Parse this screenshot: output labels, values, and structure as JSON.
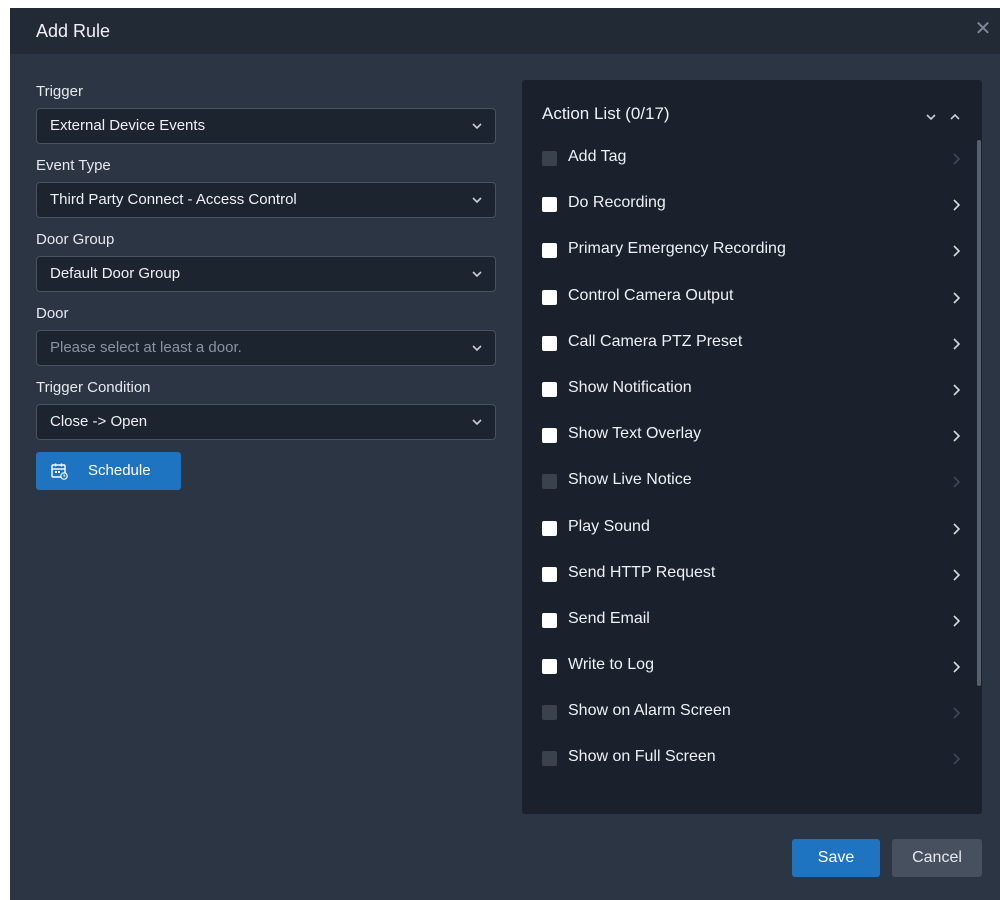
{
  "dialog": {
    "title": "Add Rule",
    "close_icon": "close-icon"
  },
  "form": {
    "fields": [
      {
        "label": "Trigger",
        "value": "External Device Events",
        "placeholder": false
      },
      {
        "label": "Event Type",
        "value": "Third Party Connect - Access Control",
        "placeholder": false
      },
      {
        "label": "Door Group",
        "value": "Default Door Group",
        "placeholder": false
      },
      {
        "label": "Door",
        "value": "Please select at least a door.",
        "placeholder": true
      },
      {
        "label": "Trigger Condition",
        "value": "Close -> Open",
        "placeholder": false
      }
    ],
    "schedule_label": "Schedule",
    "schedule_icon": "calendar-icon"
  },
  "actions": {
    "title": "Action List",
    "count": "(0/17)",
    "items": [
      {
        "label": "Add Tag",
        "disabled": true
      },
      {
        "label": "Do Recording",
        "disabled": false
      },
      {
        "label": "Primary Emergency Recording",
        "disabled": false
      },
      {
        "label": "Control Camera Output",
        "disabled": false
      },
      {
        "label": "Call Camera PTZ Preset",
        "disabled": false
      },
      {
        "label": "Show Notification",
        "disabled": false
      },
      {
        "label": "Show Text Overlay",
        "disabled": false
      },
      {
        "label": "Show Live Notice",
        "disabled": true
      },
      {
        "label": "Play Sound",
        "disabled": false
      },
      {
        "label": "Send HTTP Request",
        "disabled": false
      },
      {
        "label": "Send Email",
        "disabled": false
      },
      {
        "label": "Write to Log",
        "disabled": false
      },
      {
        "label": "Show on Alarm Screen",
        "disabled": true
      },
      {
        "label": "Show on Full Screen",
        "disabled": true
      }
    ]
  },
  "footer": {
    "save_label": "Save",
    "cancel_label": "Cancel"
  },
  "colors": {
    "accent": "#1f74c2",
    "dialog_bg": "#2c3544",
    "panel_bg": "#1a212c"
  }
}
